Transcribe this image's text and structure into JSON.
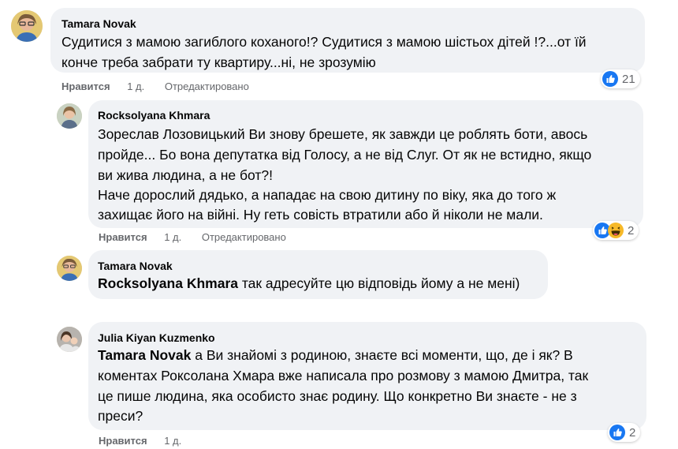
{
  "comments": [
    {
      "author": "Tamara Novak",
      "lines": [
        "Судитися з мамою загиблого коханого!? Судитися з мамою шістьох дітей !?...от їй",
        "конче треба забрати ту квартиру...ні, не зрозумію"
      ],
      "like_label": "Нравится",
      "time": "1 д.",
      "edited": "Отредактировано",
      "reaction_count": "21",
      "reactions": [
        "like-icon"
      ]
    },
    {
      "author": "Rocksolyana Khmara",
      "lines": [
        "Зореслав Лозовицький Ви знову брешете, як завжди це роблять боти, авось",
        "пройде... Бо вона депутатка від Голосу, а не від Слуг. От як не встидно, якщо",
        "ви жива людина, а не бот?!",
        "Наче дорослий дядько, а нападає на свою дитину по віку, яка до того ж",
        "захищає його на війні. Ну геть совість втратили або й ніколи не мали."
      ],
      "like_label": "Нравится",
      "time": "1 д.",
      "edited": "Отредактировано",
      "reaction_count": "2",
      "reactions": [
        "like-icon",
        "haha-icon"
      ]
    },
    {
      "author": "Tamara Novak",
      "mention": "Rocksolyana Khmara",
      "lines": [
        " так адресуйте цю відповідь йому а не мені)"
      ]
    },
    {
      "author": "Julia Kiyan Kuzmenko",
      "mention": "Tamara Novak",
      "lines": [
        " а Ви знайомі з родиною, знаєте всі моменти, що, де і як? В",
        "коментах Роксолана Хмара вже написала про розмову з мамою Дмитра, так",
        "це пише людина, яка особисто знає родину. Що конкретно Ви знаєте - не з",
        "преси?"
      ],
      "like_label": "Нравится",
      "time": "1 д.",
      "reaction_count": "2",
      "reactions": [
        "like-icon"
      ]
    }
  ],
  "colors": {
    "bubble": "#f0f2f5",
    "secondary_text": "#65676b",
    "like_blue": "#1877f2",
    "haha_yellow": "#f7b928"
  }
}
